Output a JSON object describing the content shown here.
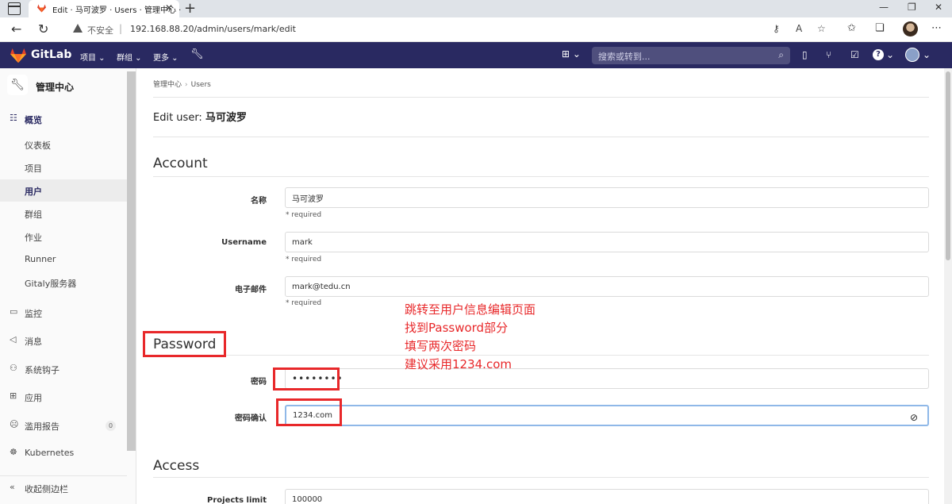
{
  "browser": {
    "tab_title": "Edit · 马可波罗 · Users · 管理中心 ·",
    "tab_close": "✕",
    "new_tab": "+",
    "insecure_label": "不安全",
    "url": "192.168.88.20/admin/users/mark/edit"
  },
  "gitlab_header": {
    "brand": "GitLab",
    "menu_projects": "项目 ⌄",
    "menu_groups": "群组 ⌄",
    "menu_more": "更多 ⌄",
    "search_placeholder": "搜索或转到..."
  },
  "sidebar": {
    "context_title": "管理中心",
    "overview": "概览",
    "items": [
      "仪表板",
      "项目",
      "用户",
      "群组",
      "作业",
      "Runner",
      "Gitaly服务器"
    ],
    "active_item": "用户",
    "sections": [
      "监控",
      "消息",
      "系统钩子",
      "应用",
      "滥用报告",
      "Kubernetes"
    ],
    "abuse_badge": "0",
    "collapse_label": "收起侧边栏"
  },
  "breadcrumb": [
    "管理中心",
    "Users"
  ],
  "page": {
    "title_prefix": "Edit user: ",
    "title_name": "马可波罗"
  },
  "account": {
    "section_title": "Account",
    "name_label": "名称",
    "name_value": "马可波罗",
    "username_label": "Username",
    "username_value": "mark",
    "email_label": "电子邮件",
    "email_value": "mark@tedu.cn",
    "required": "* required"
  },
  "password": {
    "section_title": "Password",
    "password_label": "密码",
    "password_value": "••••••••",
    "confirm_label": "密码确认",
    "confirm_value": "1234.com"
  },
  "access": {
    "section_title": "Access",
    "projects_limit_label": "Projects limit",
    "projects_limit_value": "100000"
  },
  "annotation": {
    "lines": [
      "跳转至用户信息编辑页面",
      "找到Password部分",
      "填写两次密码",
      "建议采用1234.com"
    ],
    "color": "#e8282a"
  }
}
